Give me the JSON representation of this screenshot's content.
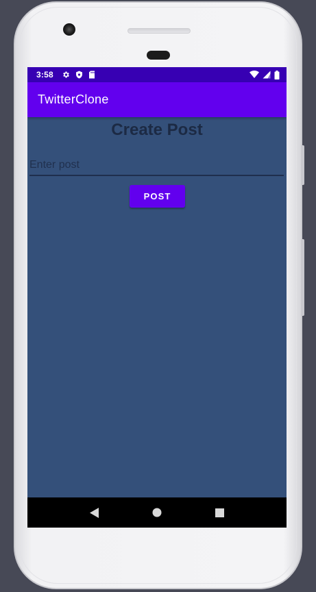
{
  "status_bar": {
    "time": "3:58",
    "left_icons": [
      "settings-icon",
      "shield-icon",
      "sd-card-icon"
    ],
    "right_icons": [
      "wifi-icon",
      "signal-icon",
      "battery-icon"
    ],
    "background": "#3700b3"
  },
  "app_bar": {
    "title": "TwitterClone",
    "background": "#6200ee"
  },
  "main": {
    "background": "#34507a",
    "heading": "Create Post",
    "post_input": {
      "placeholder": "Enter post",
      "value": ""
    },
    "post_button_label": "POST"
  },
  "nav_bar": {
    "buttons": [
      "back-icon",
      "home-icon",
      "recents-icon"
    ]
  }
}
